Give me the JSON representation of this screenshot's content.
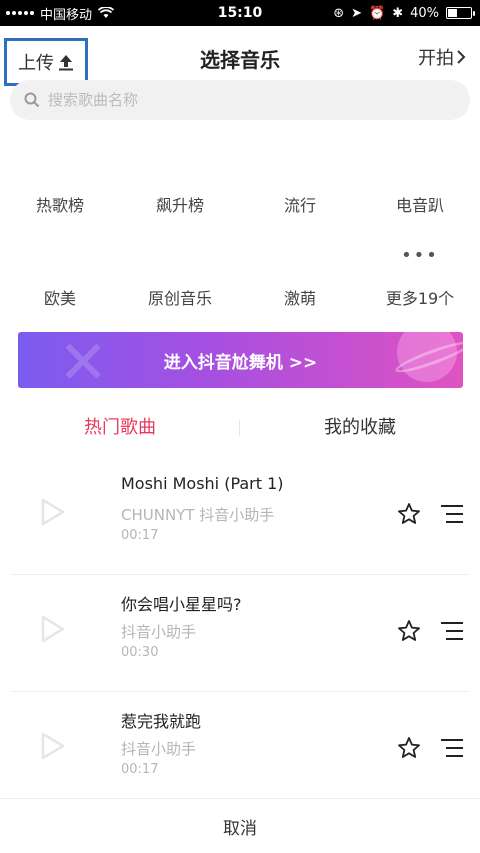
{
  "status_bar": {
    "carrier": "中国移动",
    "time": "15:10",
    "battery": "40%",
    "battery_level": 0.4
  },
  "header": {
    "upload_label": "上传",
    "title": "选择音乐",
    "start_label": "开拍"
  },
  "search": {
    "placeholder": "搜索歌曲名称"
  },
  "categories": {
    "row1": [
      "热歌榜",
      "飙升榜",
      "流行",
      "电音趴"
    ],
    "row2": [
      "欧美",
      "原创音乐",
      "激萌",
      "更多19个"
    ]
  },
  "banner": {
    "label": "进入抖音尬舞机 >>"
  },
  "tabs": {
    "hot": "热门歌曲",
    "favorites": "我的收藏"
  },
  "songs": [
    {
      "title": "Moshi Moshi (Part 1)",
      "artist": "CHUNNYT 抖音小助手",
      "duration": "00:17"
    },
    {
      "title": "你会唱小星星吗?",
      "artist": "抖音小助手",
      "duration": "00:30"
    },
    {
      "title": "惹完我就跑",
      "artist": "抖音小助手",
      "duration": "00:17"
    }
  ],
  "bottom": {
    "cancel": "取消"
  },
  "colors": {
    "accent": "#e8395a",
    "highlight_box": "#2f6fbf"
  }
}
